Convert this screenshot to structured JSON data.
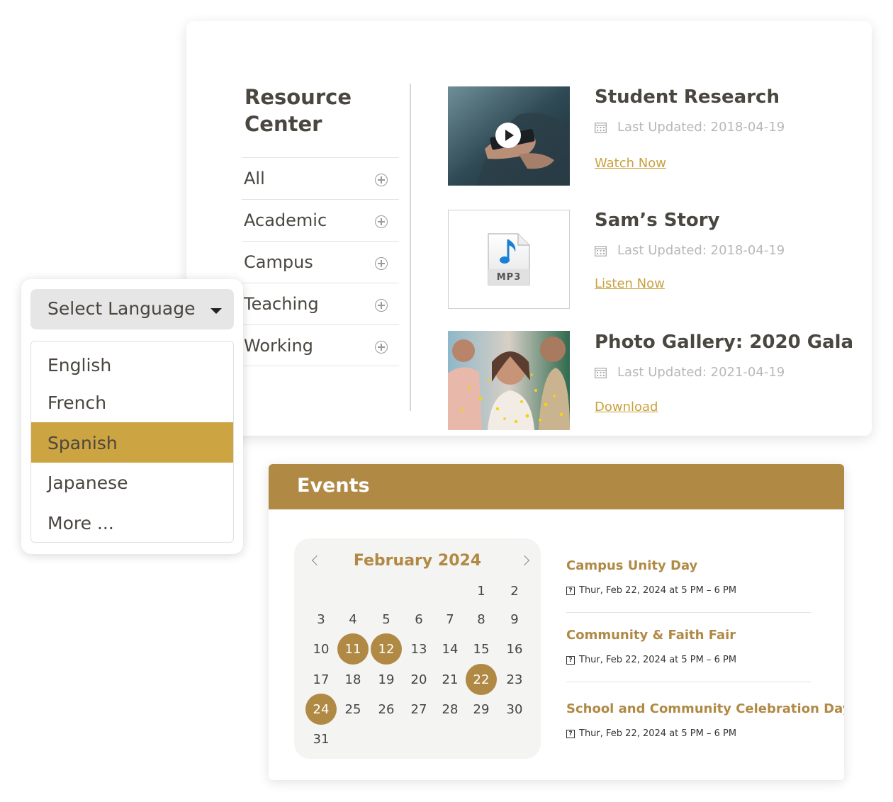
{
  "resource_center": {
    "title": "Resource Center",
    "categories": [
      {
        "label": "All"
      },
      {
        "label": "Academic"
      },
      {
        "label": "Campus"
      },
      {
        "label": "Teaching"
      },
      {
        "label": "Working"
      }
    ],
    "resources": [
      {
        "title": "Student Research",
        "updated": "Last Updated: 2018-04-19",
        "action": "Watch Now",
        "thumb": "video-thumbnail"
      },
      {
        "title": "Sam’s Story",
        "updated": "Last Updated: 2018-04-19",
        "action": "Listen Now",
        "thumb": "mp3-file-icon",
        "file_label": "MP3"
      },
      {
        "title": "Photo Gallery: 2020 Gala",
        "updated": "Last Updated: 2021-04-19",
        "action": "Download",
        "thumb": "gala-photo"
      }
    ]
  },
  "language": {
    "select_label": "Select Language",
    "options": [
      "English",
      "French",
      "Spanish",
      "Japanese",
      "More ..."
    ],
    "selected": "Spanish"
  },
  "events": {
    "title": "Events",
    "calendar": {
      "month_label": "February 2024",
      "event_days": [
        11,
        12,
        22,
        24
      ]
    },
    "items": [
      {
        "name": "Campus Unity Day",
        "time": "Thur, Feb 22, 2024 at 5 PM – 6 PM"
      },
      {
        "name": "Community & Faith Fair",
        "time": "Thur, Feb 22, 2024 at 5 PM – 6 PM"
      },
      {
        "name": "School and Community Celebration Day",
        "time": "Thur, Feb 22, 2024 at 5 PM – 6 PM"
      }
    ]
  },
  "colors": {
    "gold": "#b08a45",
    "link_gold": "#c9a13d",
    "selected_gold": "#cda442",
    "muted_text": "#b8b8b8"
  }
}
